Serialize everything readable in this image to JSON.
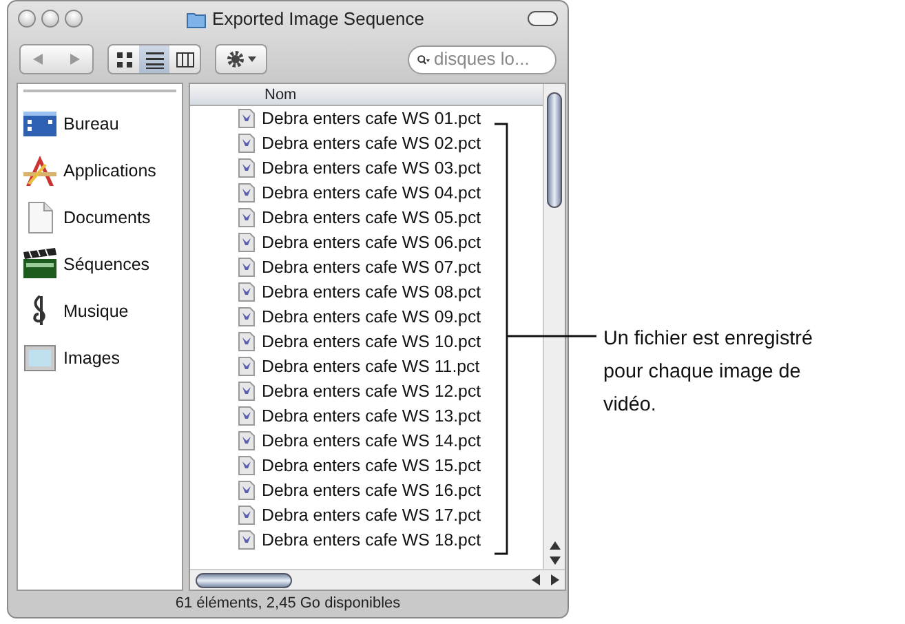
{
  "window": {
    "title": "Exported Image Sequence"
  },
  "toolbar": {
    "view_buttons": [
      {
        "kind": "icons",
        "selected": false
      },
      {
        "kind": "list",
        "selected": true
      },
      {
        "kind": "columns",
        "selected": false
      }
    ],
    "search": {
      "placeholder": "disques lo..."
    }
  },
  "sidebar": {
    "items": [
      {
        "label": "Bureau",
        "kind": "desktop"
      },
      {
        "label": "Applications",
        "kind": "applications"
      },
      {
        "label": "Documents",
        "kind": "documents"
      },
      {
        "label": "Séquences",
        "kind": "movies"
      },
      {
        "label": "Musique",
        "kind": "music"
      },
      {
        "label": "Images",
        "kind": "pictures"
      }
    ]
  },
  "file_list": {
    "columns": [
      "Nom"
    ],
    "rows": [
      "Debra enters cafe WS 01.pct",
      "Debra enters cafe WS 02.pct",
      "Debra enters cafe WS 03.pct",
      "Debra enters cafe WS 04.pct",
      "Debra enters cafe WS 05.pct",
      "Debra enters cafe WS 06.pct",
      "Debra enters cafe WS 07.pct",
      "Debra enters cafe WS 08.pct",
      "Debra enters cafe WS 09.pct",
      "Debra enters cafe WS 10.pct",
      "Debra enters cafe WS 11.pct",
      "Debra enters cafe WS 12.pct",
      "Debra enters cafe WS 13.pct",
      "Debra enters cafe WS 14.pct",
      "Debra enters cafe WS 15.pct",
      "Debra enters cafe WS 16.pct",
      "Debra enters cafe WS 17.pct",
      "Debra enters cafe WS 18.pct"
    ]
  },
  "status_bar": "61 éléments,  2,45 Go disponibles",
  "callout": "Un fichier est enregistré pour chaque image de vidéo."
}
